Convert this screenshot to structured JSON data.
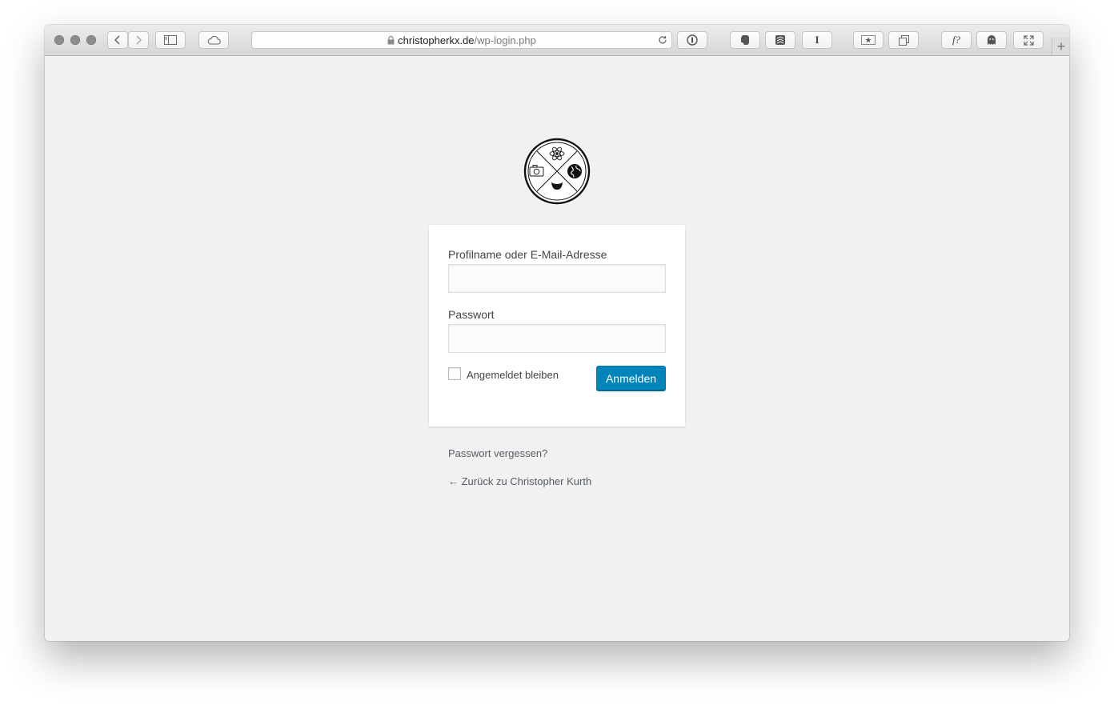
{
  "browser": {
    "url_domain": "christopherkx.de",
    "url_path": "/wp-login.php",
    "lock_icon": "lock-icon",
    "reload_icon": "reload-icon"
  },
  "toolbar_icons": [
    "back-icon",
    "forward-icon",
    "sidebar-icon",
    "cloud-icon",
    "onepassword-icon",
    "evernote-icon",
    "buffer-icon",
    "instapaper-icon",
    "bookmark-star-icon",
    "tabs-icon",
    "whatfont-icon",
    "ghostery-icon",
    "fullscreen-icon",
    "new-tab-icon"
  ],
  "toolbar_labels": {
    "instapaper": "I",
    "whatfont": "f?",
    "new_tab": "+"
  },
  "logo": {
    "caption": "Christopher Kurth",
    "icon": "site-logo-icon"
  },
  "login": {
    "username_label": "Profilname oder E-Mail-Adresse",
    "username_value": "",
    "password_label": "Passwort",
    "password_value": "",
    "remember_label": "Angemeldet bleiben",
    "remember_checked": false,
    "submit_label": "Anmelden",
    "accent_color": "#0085ba"
  },
  "links": {
    "lost_password": "Passwort vergessen?",
    "back_to_site": "← Zurück zu Christopher Kurth"
  }
}
